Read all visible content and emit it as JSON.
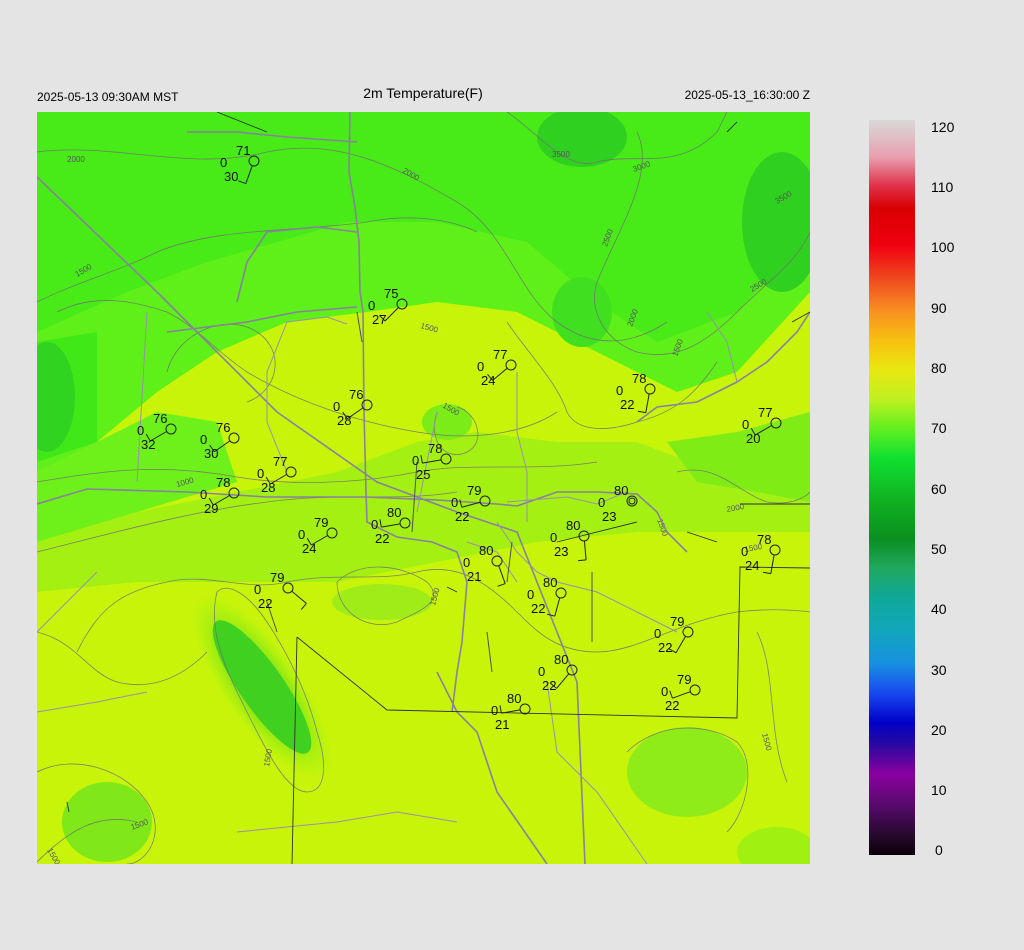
{
  "header": {
    "left": "2025-05-13 09:30AM MST",
    "title": "2m Temperature(F)",
    "right": "2025-05-13_16:30:00 Z"
  },
  "colorbar": {
    "ticks": [
      "120",
      "110",
      "100",
      "90",
      "80",
      "70",
      "60",
      "50",
      "40",
      "30",
      "20",
      "10",
      "0"
    ]
  },
  "contour_labels": [
    "2000",
    "2000",
    "3500",
    "3000",
    "2500",
    "3500",
    "2500",
    "2000",
    "1500",
    "1500",
    "1500",
    "1500",
    "1500",
    "1000",
    "2000",
    "1500",
    "1500",
    "1500",
    "1500",
    "1500",
    "1500"
  ],
  "stations": [
    {
      "t": "71",
      "c": "0",
      "d": "30"
    },
    {
      "t": "75",
      "c": "0",
      "d": "27"
    },
    {
      "t": "77",
      "c": "0",
      "d": "24"
    },
    {
      "t": "78",
      "c": "0",
      "d": "22"
    },
    {
      "t": "77",
      "c": "0",
      "d": "20"
    },
    {
      "t": "76",
      "c": "0",
      "d": "28"
    },
    {
      "t": "76",
      "c": "0",
      "d": "32"
    },
    {
      "t": "76",
      "c": "0",
      "d": "30"
    },
    {
      "t": "78",
      "c": "0",
      "d": "25"
    },
    {
      "t": "77",
      "c": "0",
      "d": "28"
    },
    {
      "t": "78",
      "c": "0",
      "d": "29"
    },
    {
      "t": "80",
      "c": "0",
      "d": "22"
    },
    {
      "t": "79",
      "c": "0",
      "d": "22"
    },
    {
      "t": "80",
      "c": "0",
      "d": "23"
    },
    {
      "t": "79",
      "c": "0",
      "d": "24"
    },
    {
      "t": "80",
      "c": "0",
      "d": "23"
    },
    {
      "t": "80",
      "c": "0",
      "d": "21"
    },
    {
      "t": "78",
      "c": "0",
      "d": "24"
    },
    {
      "t": "79",
      "c": "0",
      "d": "22"
    },
    {
      "t": "80",
      "c": "0",
      "d": "22"
    },
    {
      "t": "79",
      "c": "0",
      "d": "22"
    },
    {
      "t": "80",
      "c": "0",
      "d": "22"
    },
    {
      "t": "79",
      "c": "0",
      "d": "22"
    },
    {
      "t": "80",
      "c": "0",
      "d": "21"
    }
  ]
}
